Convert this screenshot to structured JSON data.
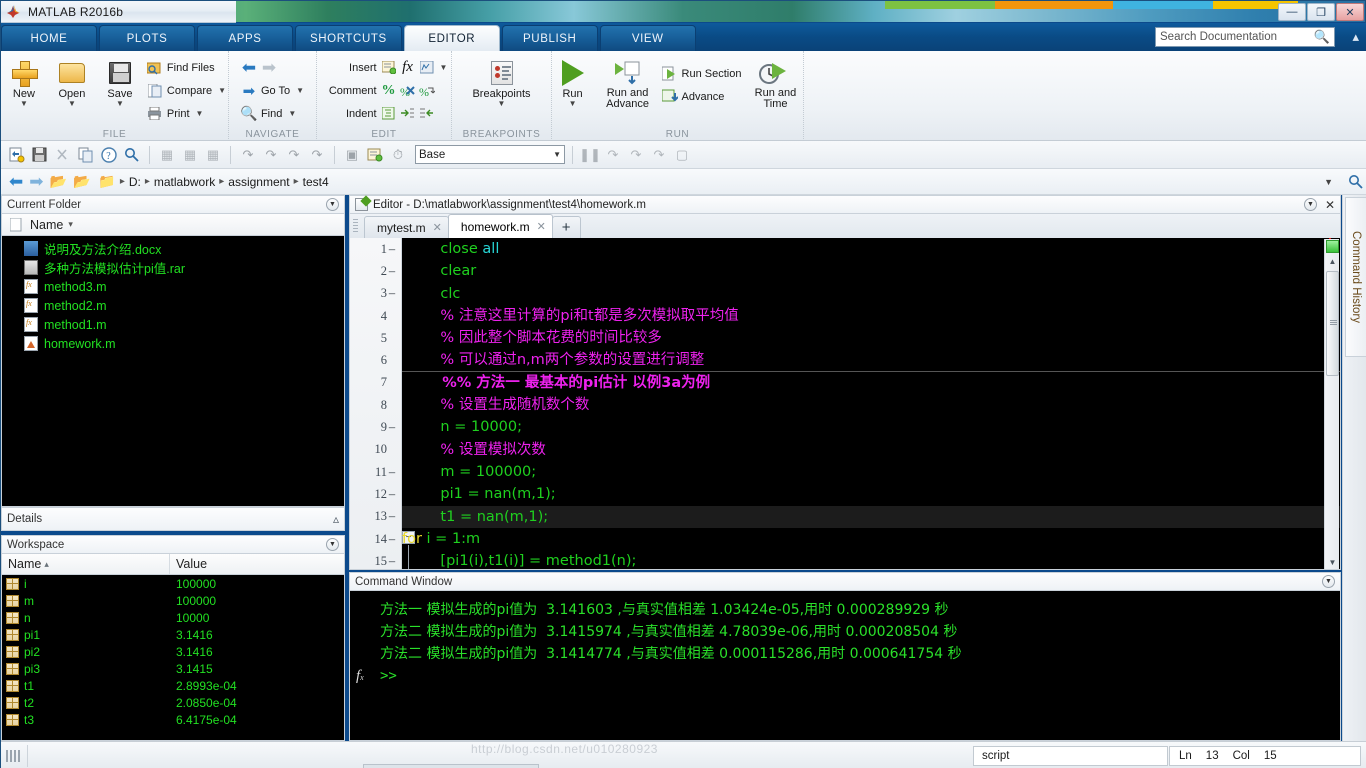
{
  "window": {
    "app_title": "MATLAB R2016b",
    "minimize": "—",
    "restore": "❐",
    "close": "✕"
  },
  "ribbon_tabs": [
    {
      "label": "HOME",
      "active": false
    },
    {
      "label": "PLOTS",
      "active": false
    },
    {
      "label": "APPS",
      "active": false
    },
    {
      "label": "SHORTCUTS",
      "active": false
    },
    {
      "label": "EDITOR",
      "active": true
    },
    {
      "label": "PUBLISH",
      "active": false
    },
    {
      "label": "VIEW",
      "active": false
    }
  ],
  "search": {
    "placeholder": "Search Documentation",
    "icon": "search-icon"
  },
  "ribbon": {
    "groups": [
      {
        "title": "FILE",
        "big_buttons": [
          {
            "label": "New",
            "icon": "new-plus-icon",
            "has_caret": true
          },
          {
            "label": "Open",
            "icon": "open-folder-icon",
            "has_caret": true
          },
          {
            "label": "Save",
            "icon": "save-floppy-icon",
            "has_caret": true
          }
        ],
        "small_buttons": [
          {
            "label": "Find Files",
            "icon": "find-files-icon",
            "has_caret": false
          },
          {
            "label": "Compare",
            "icon": "compare-icon",
            "has_caret": true
          },
          {
            "label": "Print",
            "icon": "print-icon",
            "has_caret": true
          }
        ]
      },
      {
        "title": "NAVIGATE",
        "small_buttons": [
          {
            "label": "",
            "icon": "back-arrow-icon",
            "has_caret": false
          },
          {
            "label": "Go To",
            "icon": "goto-icon",
            "has_caret": true
          },
          {
            "label": "Find",
            "icon": "find-icon",
            "has_caret": true
          }
        ]
      },
      {
        "title": "EDIT",
        "rows": [
          {
            "label": "Insert",
            "icons": [
              "insert-block-icon",
              "function-fx-icon",
              "insert-fi-icon",
              "more-caret-icon"
            ]
          },
          {
            "label": "Comment",
            "icons": [
              "comment-percent-icon",
              "uncomment-icon",
              "wrap-comment-icon"
            ]
          },
          {
            "label": "Indent",
            "icons": [
              "smart-indent-icon",
              "indent-right-icon",
              "indent-left-icon"
            ]
          }
        ]
      },
      {
        "title": "BREAKPOINTS",
        "big_buttons": [
          {
            "label": "Breakpoints",
            "icon": "breakpoints-icon",
            "has_caret": true
          }
        ]
      },
      {
        "title": "RUN",
        "big_buttons": [
          {
            "label": "Run",
            "icon": "run-play-icon",
            "has_caret": true
          },
          {
            "label": "Run and Advance",
            "icon": "run-advance-icon",
            "has_caret": false
          },
          {
            "label": "Run and Time",
            "icon": "run-time-icon",
            "has_caret": false
          }
        ],
        "small_buttons": [
          {
            "label": "Run Section",
            "icon": "run-section-icon",
            "has_caret": false
          },
          {
            "label": "Advance",
            "icon": "advance-icon",
            "has_caret": false
          }
        ]
      }
    ]
  },
  "toolbar2": {
    "icons": [
      "new-script-icon",
      "save-icon",
      "cut-icon",
      "copy-icon",
      "help-icon",
      "search-icon"
    ],
    "workspace_label": "Base"
  },
  "address_bar": {
    "back_icon": "back-arrow-icon",
    "forward_icon": "forward-arrow-icon",
    "up_icon": "up-folder-icon",
    "browse_icon": "browse-folder-icon",
    "crumbs": [
      "D:",
      "matlabwork",
      "assignment",
      "test4"
    ],
    "separator": "▸"
  },
  "current_folder": {
    "title": "Current Folder",
    "column_header": "Name",
    "sort_caret": "▾",
    "files": [
      {
        "name": "说明及方法介绍.docx",
        "icon": "word-doc-icon"
      },
      {
        "name": "多种方法模拟估计pi值.rar",
        "icon": "rar-archive-icon"
      },
      {
        "name": "method3.m",
        "icon": "m-file-icon"
      },
      {
        "name": "method2.m",
        "icon": "m-file-icon"
      },
      {
        "name": "method1.m",
        "icon": "m-file-icon"
      },
      {
        "name": "homework.m",
        "icon": "m-script-icon"
      }
    ]
  },
  "details": {
    "title": "Details",
    "collapse_icon": "chevron-up-icon"
  },
  "workspace": {
    "title": "Workspace",
    "columns": [
      "Name",
      "Value"
    ],
    "sort_arrow": "▴",
    "rows": [
      {
        "name": "i",
        "value": "100000"
      },
      {
        "name": "m",
        "value": "100000"
      },
      {
        "name": "n",
        "value": "10000"
      },
      {
        "name": "pi1",
        "value": "3.1416"
      },
      {
        "name": "pi2",
        "value": "3.1416"
      },
      {
        "name": "pi3",
        "value": "3.1415"
      },
      {
        "name": "t1",
        "value": "2.8993e-04"
      },
      {
        "name": "t2",
        "value": "2.0850e-04"
      },
      {
        "name": "t3",
        "value": "6.4175e-04"
      }
    ]
  },
  "editor": {
    "title": "Editor - D:\\matlabwork\\assignment\\test4\\homework.m",
    "tabs": [
      {
        "label": "mytest.m",
        "active": false,
        "close": "✕"
      },
      {
        "label": "homework.m",
        "active": true,
        "close": "✕"
      }
    ],
    "new_tab_label": "+",
    "lines": [
      {
        "num": "1",
        "dash": "–",
        "fold": "",
        "highlight": false,
        "tokens": [
          {
            "t": "    close ",
            "c": "c-green"
          },
          {
            "t": "all",
            "c": "c-cyan"
          }
        ]
      },
      {
        "num": "2",
        "dash": "–",
        "fold": "",
        "highlight": false,
        "tokens": [
          {
            "t": "    clear",
            "c": "c-green"
          }
        ]
      },
      {
        "num": "3",
        "dash": "–",
        "fold": "",
        "highlight": false,
        "tokens": [
          {
            "t": "    clc",
            "c": "c-green"
          }
        ]
      },
      {
        "num": "4",
        "dash": "",
        "fold": "",
        "highlight": false,
        "tokens": [
          {
            "t": "    % 注意这里计算的pi和t都是多次模拟取平均值",
            "c": "c-mag"
          }
        ]
      },
      {
        "num": "5",
        "dash": "",
        "fold": "",
        "highlight": false,
        "tokens": [
          {
            "t": "    % 因此整个脚本花费的时间比较多",
            "c": "c-mag"
          }
        ]
      },
      {
        "num": "6",
        "dash": "",
        "fold": "",
        "highlight": false,
        "tokens": [
          {
            "t": "    % 可以通过n,m两个参数的设置进行调整",
            "c": "c-mag"
          }
        ]
      },
      {
        "num": "7",
        "dash": "",
        "fold": "",
        "highlight": false,
        "section": true,
        "tokens": [
          {
            "t": "    %% 方法一 最基本的pi估计 以例3a为例",
            "c": "c-mag"
          }
        ]
      },
      {
        "num": "8",
        "dash": "",
        "fold": "",
        "highlight": false,
        "tokens": [
          {
            "t": "    % 设置生成随机数个数",
            "c": "c-mag"
          }
        ]
      },
      {
        "num": "9",
        "dash": "–",
        "fold": "",
        "highlight": false,
        "tokens": [
          {
            "t": "    n = 10000;",
            "c": "c-green"
          }
        ]
      },
      {
        "num": "10",
        "dash": "",
        "fold": "",
        "highlight": false,
        "tokens": [
          {
            "t": "    % 设置模拟次数",
            "c": "c-mag"
          }
        ]
      },
      {
        "num": "11",
        "dash": "–",
        "fold": "",
        "highlight": false,
        "tokens": [
          {
            "t": "    m = 100000;",
            "c": "c-green"
          }
        ]
      },
      {
        "num": "12",
        "dash": "–",
        "fold": "",
        "highlight": false,
        "tokens": [
          {
            "t": "    pi1 = nan(m,1);",
            "c": "c-green"
          }
        ]
      },
      {
        "num": "13",
        "dash": "–",
        "fold": "",
        "highlight": true,
        "tokens": [
          {
            "t": "    t1 = nan(m,1);",
            "c": "c-green"
          }
        ]
      },
      {
        "num": "14",
        "dash": "–",
        "fold": "−",
        "highlight": false,
        "tokens": [
          {
            "t": "for ",
            "c": "c-yellow"
          },
          {
            "t": "i = 1:m",
            "c": "c-green"
          }
        ]
      },
      {
        "num": "15",
        "dash": "–",
        "fold": "",
        "highlight": false,
        "tokens": [
          {
            "t": "    [pi1(i),t1(i)] = method1(n);",
            "c": "c-green"
          }
        ]
      }
    ],
    "scroll_marker_color": "#39c239"
  },
  "command_window": {
    "title": "Command Window",
    "prompt_icon": "fx-icon",
    "lines": [
      "方法一 模拟生成的pi值为  3.141603 ,与真实值相差 1.03424e-05,用时 0.000289929 秒",
      "方法二 模拟生成的pi值为  3.1415974 ,与真实值相差 4.78039e-06,用时 0.000208504 秒",
      "方法二 模拟生成的pi值为  3.1414774 ,与真实值相差 0.000115286,用时 0.000641754 秒"
    ],
    "prompt": ">>"
  },
  "command_history": {
    "label": "Command History"
  },
  "status_bar": {
    "file_type": "script",
    "line_label": "Ln",
    "line_value": "13",
    "col_label": "Col",
    "col_value": "15",
    "watermark": "http://blog.csdn.net/u010280923"
  },
  "colors": {
    "panel_bg": "#000000",
    "code_green": "#1fd01f",
    "code_cyan": "#27d6d6",
    "code_magenta": "#ee22ee",
    "code_yellow": "#e8d82a",
    "ruler_red": "#e01010",
    "ribbon_blue": "#0a4b85",
    "text_green": "#22e022"
  }
}
